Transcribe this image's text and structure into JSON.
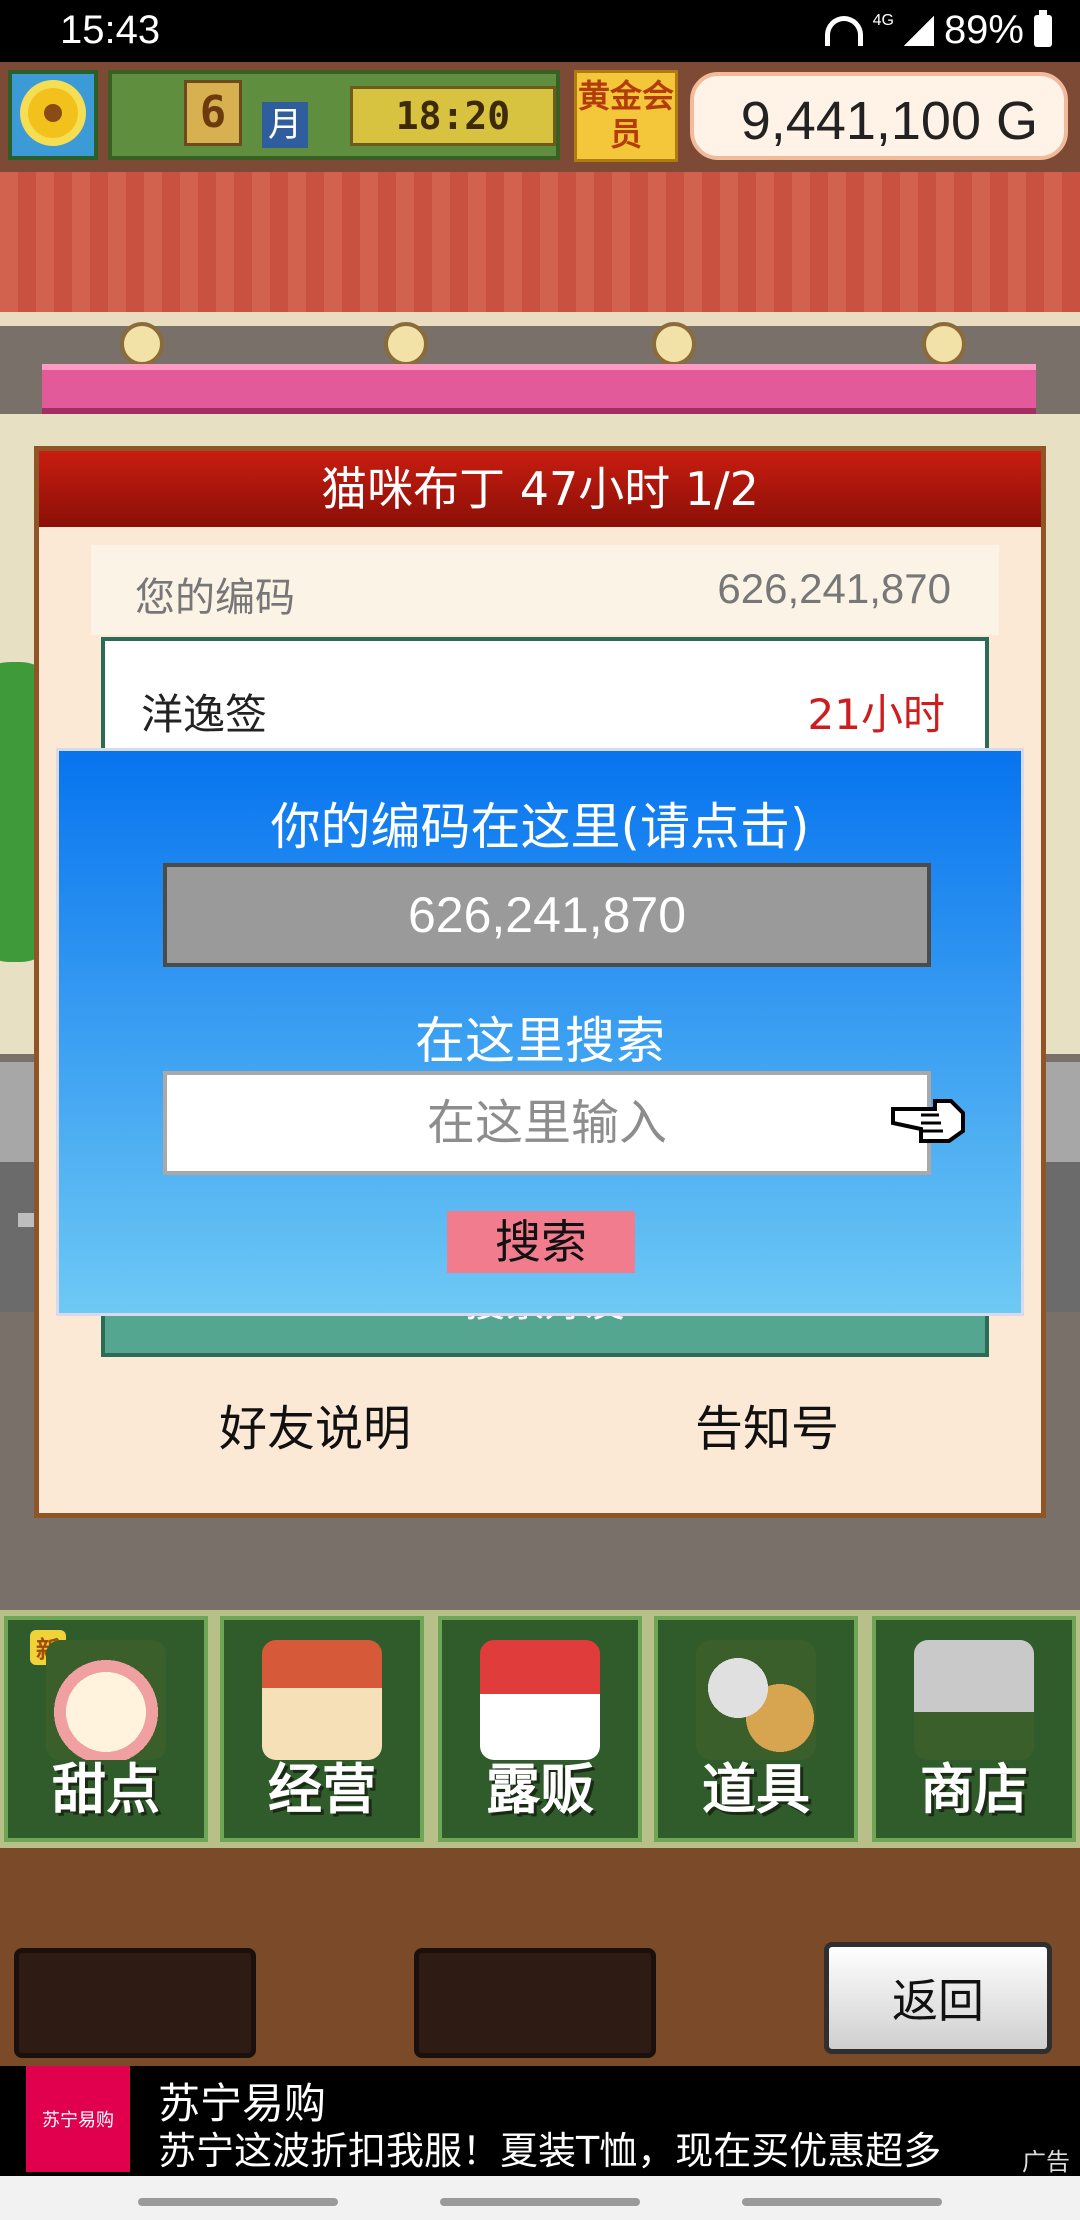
{
  "status_bar": {
    "time": "15:43",
    "network": "4G",
    "battery": "89%"
  },
  "hud": {
    "month": "6",
    "month_label": "月",
    "clock": "18:20",
    "member_badge": "黄金会员",
    "money": "9,441,100 G"
  },
  "friend_panel": {
    "title": "猫咪布丁 47小时 1/2",
    "code_label": "您的编码",
    "code_value": "626,241,870",
    "list_fragment_left": "洋逸签",
    "list_fragment_right": "21小时",
    "search_friend_label": "搜索好友",
    "friend_help_label": "好友说明",
    "notice_label": "告知号"
  },
  "modal": {
    "title": "你的编码在这里(请点击)",
    "code": "626,241,870",
    "search_title": "在这里搜索",
    "search_placeholder": "在这里输入",
    "search_button": "搜索"
  },
  "menu": {
    "items": [
      {
        "label": "甜点",
        "badge": "新"
      },
      {
        "label": "经营"
      },
      {
        "label": "露贩"
      },
      {
        "label": "道具"
      },
      {
        "label": "商店"
      }
    ]
  },
  "back_button": "返回",
  "ad": {
    "logo_text": "苏宁易购",
    "title": "苏宁易购",
    "description": "苏宁这波折扣我服！夏装T恤，现在买优惠超多",
    "tag": "广告"
  },
  "colors": {
    "modal_top": "#0774ef",
    "modal_bottom": "#6ec9f4",
    "search_button": "#f07c8d",
    "panel_title": "#c91d10",
    "ad_logo": "#e0004d"
  }
}
